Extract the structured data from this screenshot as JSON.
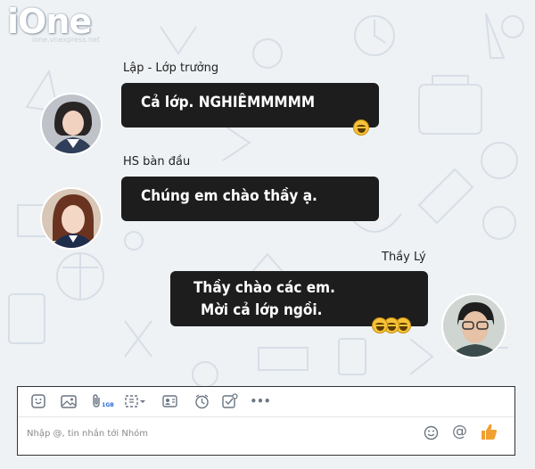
{
  "watermark": {
    "brand": "iOne",
    "tagline": "ione.vnexpress.net"
  },
  "messages": [
    {
      "sender": "Lập - Lớp trưởng",
      "lines": [
        "Cả lớp. NGHIÊMMMMM"
      ],
      "reaction": "laughing-emoji"
    },
    {
      "sender": "HS bàn đầu",
      "lines": [
        "Chúng em chào thầy ạ."
      ]
    },
    {
      "sender": "Thầy Lý",
      "lines": [
        "Thầy chào các em.",
        "Mời cả lớp ngồi."
      ],
      "reaction": "laughing-emoji-x3"
    }
  ],
  "composer": {
    "placeholder": "Nhập @, tin nhắn tới Nhóm",
    "file_badge": "1GB",
    "tools": [
      "sticker-icon",
      "image-icon",
      "attach-file-icon",
      "screenshot-icon",
      "contact-card-icon",
      "reminder-icon",
      "task-icon",
      "more-icon"
    ],
    "more_label": "•••",
    "right_icons": [
      "emoji-icon",
      "mention-icon",
      "thumbs-up-icon"
    ],
    "mention_label": "@"
  },
  "colors": {
    "bubble": "#1d1d1d",
    "bubble_text": "#ffffff",
    "background": "#eef2f5",
    "like": "#f0a030"
  }
}
